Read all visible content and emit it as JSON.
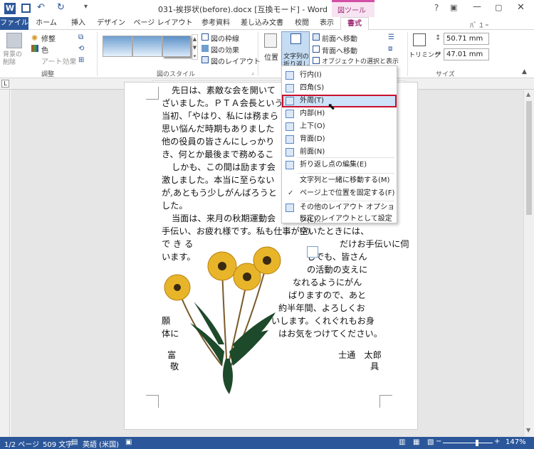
{
  "window": {
    "title": "031-挨拶状(before).docx [互換モード] - Word",
    "context_tab_group": "図ツール",
    "user": "ﾊﾞ ﾕ ｰ",
    "colors": {
      "accent": "#2b579a",
      "context": "#d24fa5",
      "highlight": "#c8102e"
    }
  },
  "tabs": [
    "ファイル",
    "ホーム",
    "挿入",
    "デザイン",
    "ページ レイアウト",
    "参考資料",
    "差し込み文書",
    "校閲",
    "表示",
    "書式"
  ],
  "ribbon": {
    "adjust": {
      "remove_bg": "背景の削除",
      "corrections": "修整",
      "color": "色",
      "artistic": "アート効果",
      "label": "調整"
    },
    "styles": {
      "border": "図の枠線",
      "effects": "図の効果",
      "layout": "図のレイアウト",
      "label": "図のスタイル"
    },
    "arrange": {
      "position": "位置",
      "wrap_line1": "文字列の",
      "wrap_line2": "折り返し",
      "bring_forward": "前面へ移動",
      "send_backward": "背面へ移動",
      "selection_pane": "オブジェクトの選択と表示"
    },
    "size": {
      "crop": "トリミング",
      "height": "50.71 mm",
      "width": "47.01 mm",
      "label": "サイズ"
    }
  },
  "menu": {
    "items": [
      "行内(I)",
      "四角(S)",
      "外周(T)",
      "内部(H)",
      "上下(O)",
      "背面(D)",
      "前面(N)"
    ],
    "edit_points": "折り返し点の編集(E)",
    "move_with_text": "文字列と一緒に移動する(M)",
    "fix_position": "ページ上で位置を固定する(F)",
    "more_options": "その他のレイアウト オプション(L)...",
    "set_default": "既定のレイアウトとして設定(A)"
  },
  "document": {
    "lines": [
      "先日は、素敵な会を開いて",
      "ざいました。ＰＴＡ会長という",
      "当初、「やはり、私には務まら",
      "思い悩んだ時期もありました",
      "他の役員の皆さんにしっかり",
      "き、何とか最後まで務めるこ",
      "しかも、この間は励ます会",
      "激しました。本当に至らない",
      "が,あともう少しがんばろうと",
      "した。",
      "当面は、来月の秋期運動会",
      "手伝い、お疲れ様です。私も仕事が空いたときには、",
      "で き る",
      "います。"
    ],
    "right_lines": [
      "だけお手伝いに伺",
      "しでも、皆さん",
      "の活動の支えに",
      "なれるようにがん",
      "ばりますので、あと",
      "約半年間、よろしくお",
      "いします。くれぐれもお身",
      "はお気をつけてください。"
    ],
    "left_lines": [
      "願",
      "体に",
      "富",
      "敬"
    ],
    "signature_name": "士通　太郎",
    "signature_suffix": "具"
  },
  "status": {
    "page": "1/2 ページ",
    "words": "509 文字",
    "language": "英語 (米国)",
    "zoom": "147%"
  }
}
